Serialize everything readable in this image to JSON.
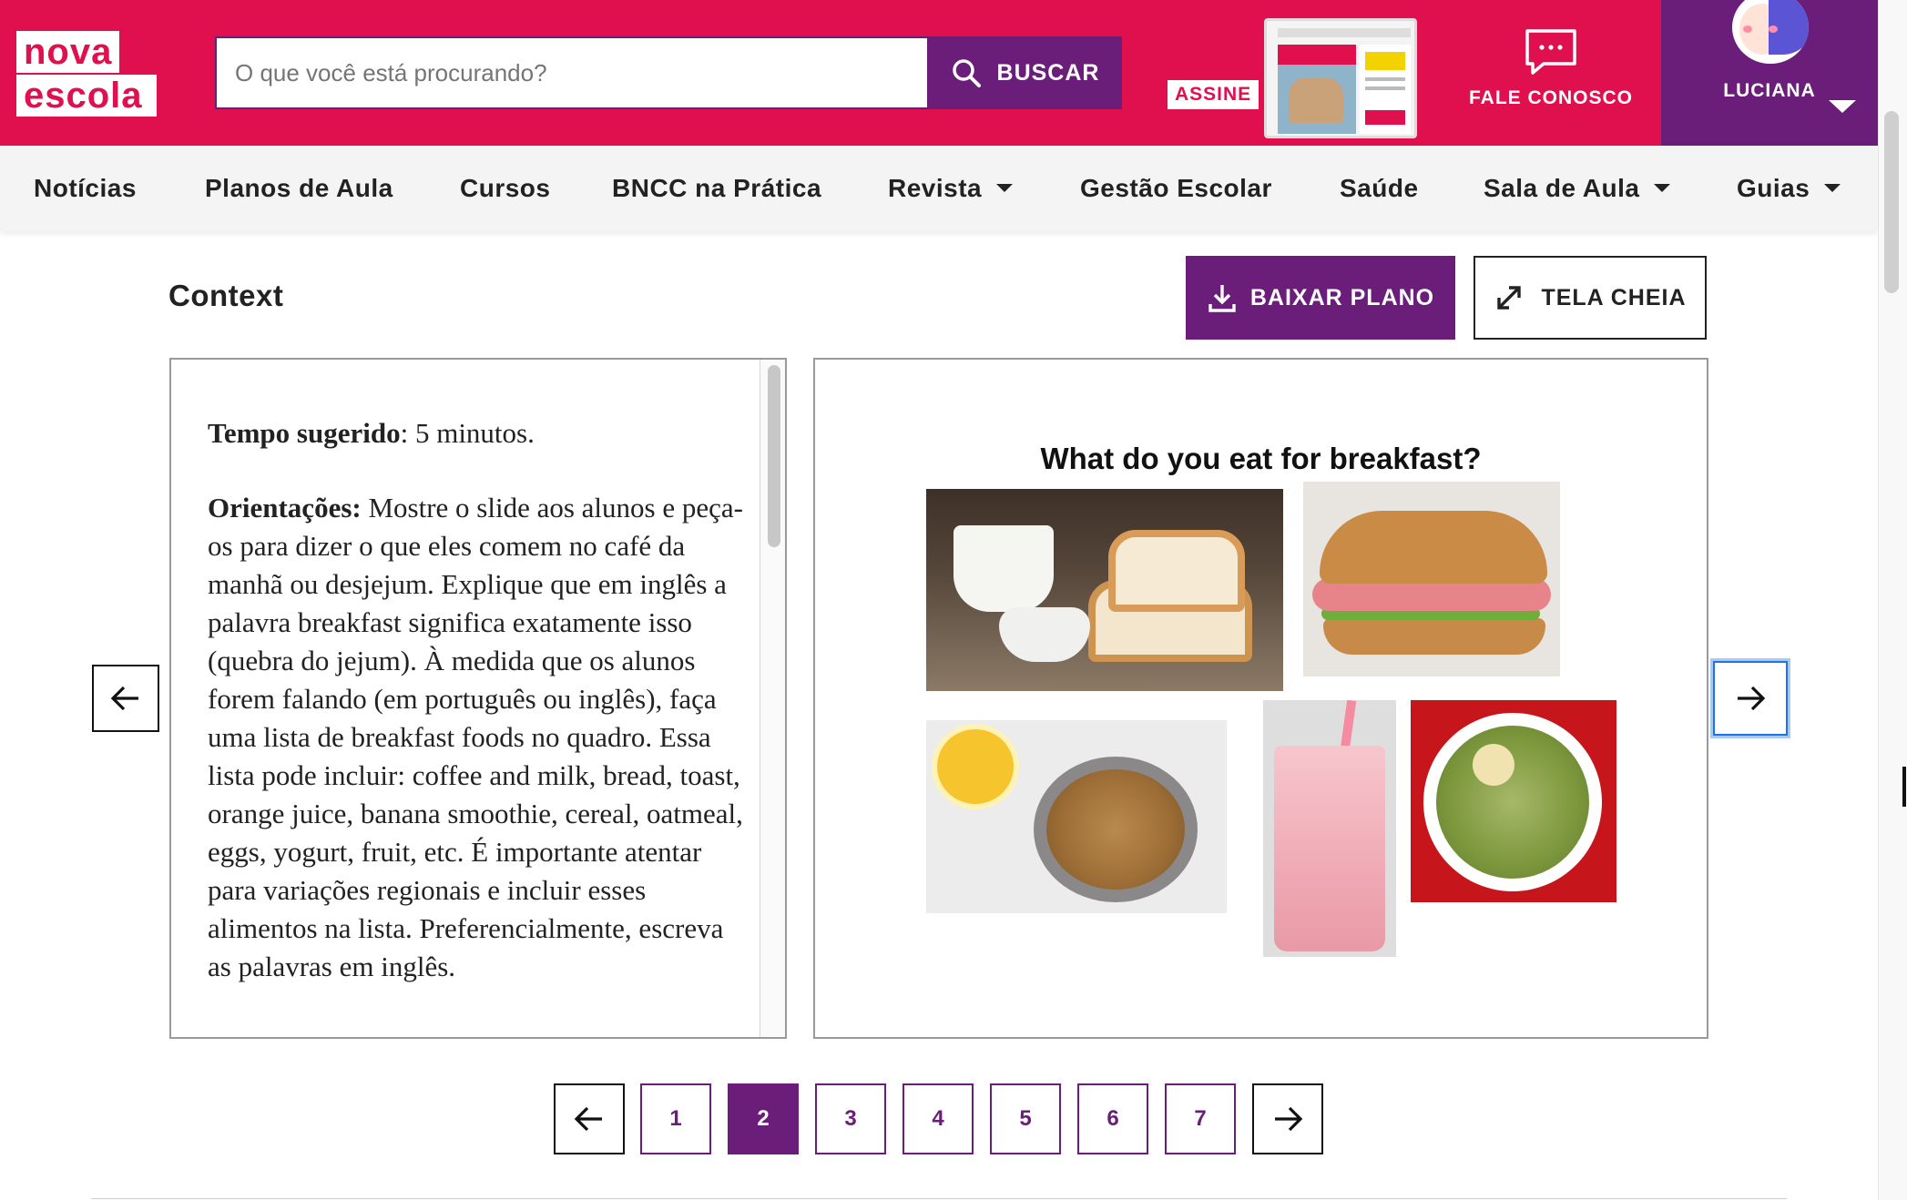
{
  "logo": {
    "line1": "nova",
    "line2": "escola"
  },
  "search": {
    "placeholder": "O que você está procurando?",
    "button_label": "BUSCAR"
  },
  "promo": {
    "assine_label": "ASSINE"
  },
  "contact": {
    "label": "FALE CONOSCO"
  },
  "user": {
    "name": "LUCIANA"
  },
  "nav": {
    "items": [
      {
        "label": "Notícias"
      },
      {
        "label": "Planos de Aula"
      },
      {
        "label": "Cursos"
      },
      {
        "label": "BNCC na Prática"
      },
      {
        "label": "Revista",
        "has_dropdown": true
      },
      {
        "label": "Gestão Escolar"
      },
      {
        "label": "Saúde"
      },
      {
        "label": "Sala de Aula",
        "has_dropdown": true
      },
      {
        "label": "Guias",
        "has_dropdown": true
      }
    ]
  },
  "lesson": {
    "section_title": "Context",
    "download_label": "BAIXAR PLANO",
    "fullscreen_label": "TELA CHEIA",
    "tempo_label": "Tempo sugerido",
    "tempo_value": ": 5 minutos.",
    "orient_label": "Orientações:",
    "orient_text": " Mostre o slide aos alunos e peça-os para dizer o que eles comem no café da manhã ou desjejum. Explique que em inglês a palavra breakfast significa exatamente isso (quebra do jejum). À medida que os alunos forem falando (em português ou inglês), faça uma lista de breakfast foods no quadro. Essa lista pode incluir: coffee and milk, bread, toast, orange juice, banana smoothie, cereal, oatmeal, eggs, yogurt, fruit, etc. É importante atentar para variações regionais e incluir esses alimentos na lista. Preferencialmente, escreva as palavras em inglês."
  },
  "slide": {
    "title": "What do you eat for breakfast?",
    "images": [
      "coffee-and-bread-photo",
      "ham-sandwich-photo",
      "orange-juice-and-cereal-photo",
      "strawberry-smoothie-photo",
      "vegetable-soup-photo"
    ]
  },
  "pagination": {
    "pages": [
      "1",
      "2",
      "3",
      "4",
      "5",
      "6",
      "7"
    ],
    "current_page": "2"
  },
  "colors": {
    "brand_pink": "#e0104f",
    "brand_purple": "#6b1d7a",
    "focus_blue": "#1a73e8"
  }
}
